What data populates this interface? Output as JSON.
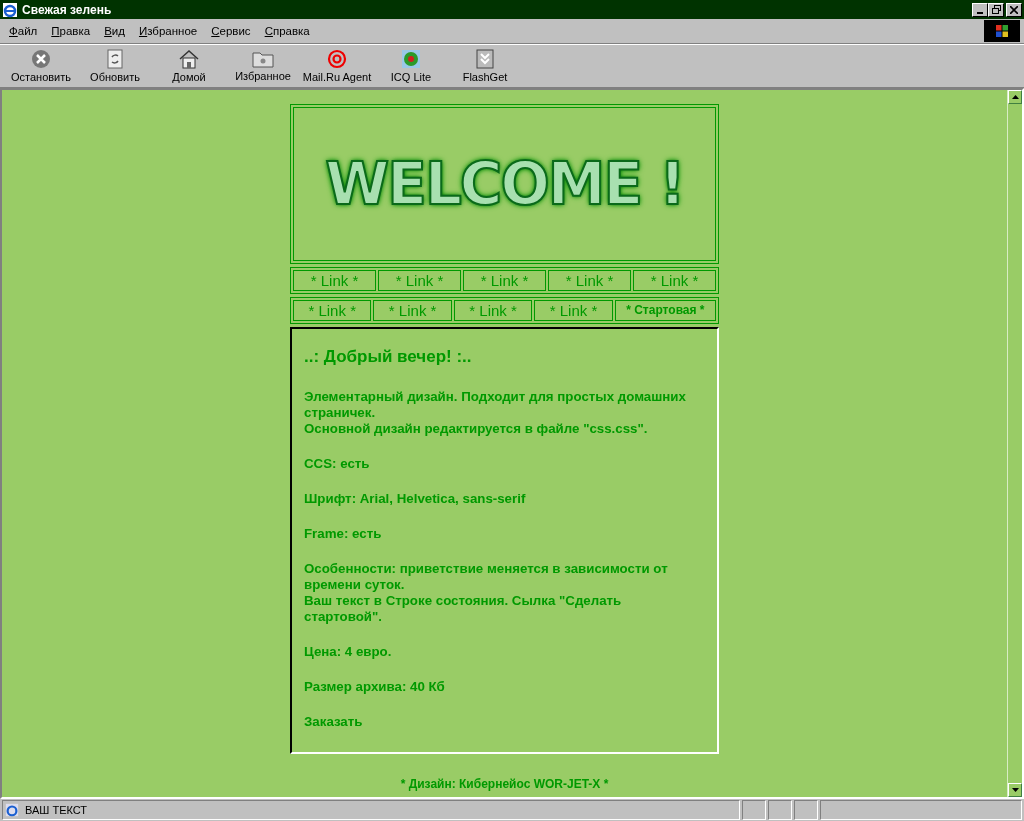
{
  "window": {
    "title": "Свежая зелень"
  },
  "menu": [
    "Файл",
    "Правка",
    "Вид",
    "Избранное",
    "Сервис",
    "Справка"
  ],
  "toolbar": [
    {
      "label": "Остановить",
      "kind": "stop"
    },
    {
      "label": "Обновить",
      "kind": "refresh"
    },
    {
      "label": "Домой",
      "kind": "home"
    },
    {
      "label": "Избранное",
      "kind": "favorites"
    },
    {
      "label": "Mail.Ru Agent",
      "kind": "at"
    },
    {
      "label": "ICQ Lite",
      "kind": "flower"
    },
    {
      "label": "FlashGet",
      "kind": "download"
    }
  ],
  "banner": {
    "text": "WELCOME !"
  },
  "nav_rows": [
    [
      {
        "label": "* Link *",
        "bold": false
      },
      {
        "label": "* Link *",
        "bold": false
      },
      {
        "label": "* Link *",
        "bold": false
      },
      {
        "label": "* Link *",
        "bold": false
      },
      {
        "label": "* Link *",
        "bold": false
      }
    ],
    [
      {
        "label": "* Link *",
        "bold": false
      },
      {
        "label": "* Link *",
        "bold": false
      },
      {
        "label": "* Link *",
        "bold": false
      },
      {
        "label": "* Link *",
        "bold": false
      },
      {
        "label": "* Стартовая *",
        "bold": true
      }
    ]
  ],
  "content": {
    "heading": "..: Добрый вечер! :..",
    "paragraphs": [
      [
        "Элементарный дизайн. Подходит для простых домашних страничек.",
        "Основной дизайн редактируется в файле \"css.css\"."
      ],
      [
        "CCS: есть"
      ],
      [
        "Шрифт: Arial, Helvetica, sans-serif"
      ],
      [
        "Frame: есть"
      ],
      [
        "Особенности: приветствие меняется в зависимости от времени суток.",
        "Ваш текст в Строке состояния. Сылка \"Сделать стартовой\"."
      ],
      [
        "Цена: 4 евро."
      ],
      [
        "Размер архива: 40 Кб"
      ],
      [
        "Заказать"
      ]
    ]
  },
  "footer": "* Дизайн: Кибернейос WOR-JET-X *",
  "status_bar": {
    "text": "ВАШ ТЕКСТ"
  }
}
